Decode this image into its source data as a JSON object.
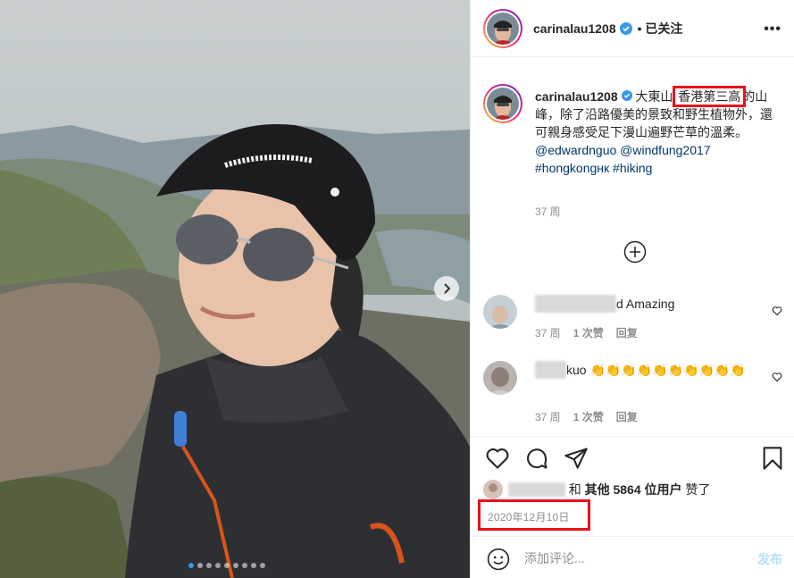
{
  "post": {
    "username": "carinalau1208",
    "follow_status": "已关注",
    "more_label": "•••"
  },
  "caption": {
    "username": "carinalau1208",
    "text_part1": "大東山",
    "highlight": "香港第三高",
    "text_part2": "的山峰，除了沿路優美的景致和野生植物外，還可親身感受足下漫山遍野芒草的溫柔。",
    "mention1": "@edwardnguo",
    "mention2": "@windfung2017",
    "hashtag1": "#hongkongнк",
    "hashtag2": "#hiking",
    "time": "37 周"
  },
  "comments": [
    {
      "user_blurred": "xxxxxxxxxxxxx",
      "text": "d Amazing",
      "time": "37 周",
      "likes": "1 次赞",
      "reply": "回复"
    },
    {
      "user_blurred": "xxxxx",
      "text": "kuo 👏👏👏👏👏👏👏👏👏👏",
      "time": "37 周",
      "likes": "1 次赞",
      "reply": "回复"
    }
  ],
  "likes": {
    "user_blurred": "xxxxxxxxg",
    "and": "和",
    "others": "其他 5864 位用户",
    "suffix": "赞了"
  },
  "date": "2020年12月10日",
  "comment_box": {
    "placeholder": "添加评论...",
    "post_label": "发布"
  },
  "carousel": {
    "total": 9,
    "active": 1
  },
  "colors": {
    "accent": "#3897f0",
    "link": "#00376b",
    "highlight_box": "#e8121b",
    "muted": "#8e8e8e"
  }
}
